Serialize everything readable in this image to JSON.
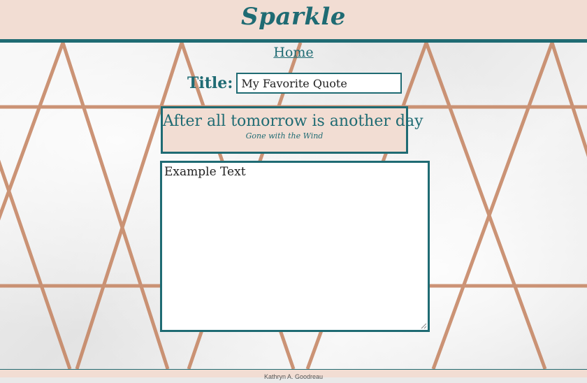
{
  "header": {
    "brand": "Sparkle"
  },
  "nav": {
    "home_label": "Home"
  },
  "form": {
    "title_label": "Title:",
    "title_value": "My Favorite Quote"
  },
  "quote": {
    "text": "After all tomorrow is another day",
    "source": "Gone with the Wind"
  },
  "editor": {
    "value": "Example Text"
  },
  "footer": {
    "author": "Kathryn A. Goodreau"
  },
  "colors": {
    "accent": "#1f6b73",
    "blush": "#f2ddd3",
    "rose_gold": "#c98a6a"
  }
}
